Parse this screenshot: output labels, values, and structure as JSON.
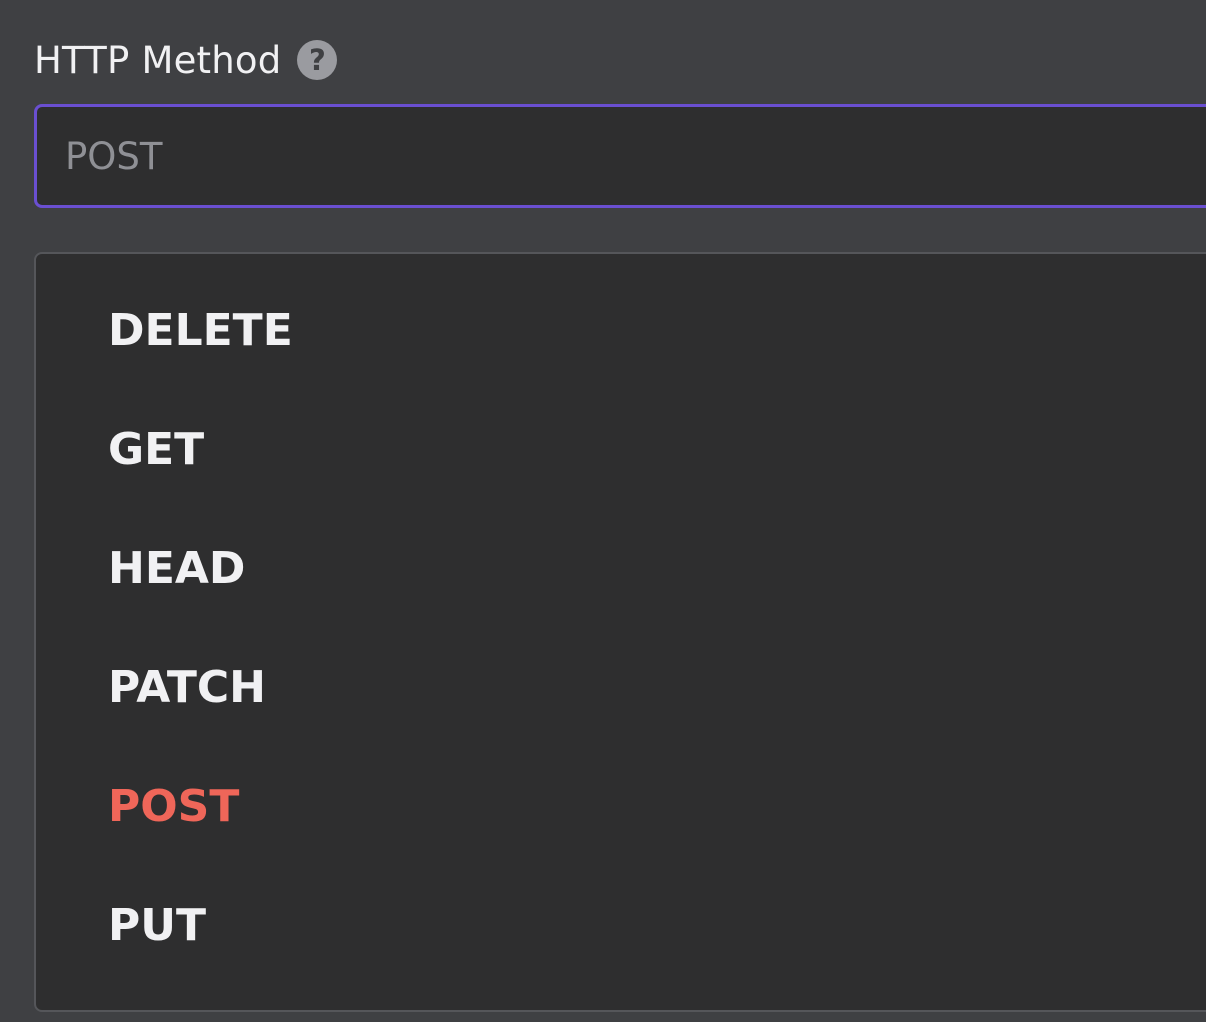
{
  "field": {
    "label": "HTTP Method",
    "help_icon": "question-circle-icon",
    "help_glyph": "?"
  },
  "select": {
    "value": "POST"
  },
  "options": [
    {
      "label": "DELETE",
      "selected": false
    },
    {
      "label": "GET",
      "selected": false
    },
    {
      "label": "HEAD",
      "selected": false
    },
    {
      "label": "PATCH",
      "selected": false
    },
    {
      "label": "POST",
      "selected": true
    },
    {
      "label": "PUT",
      "selected": false
    }
  ],
  "colors": {
    "background": "#3f4043",
    "input_bg": "#2e2e2f",
    "focus_border": "#6a4fd1",
    "selected_option": "#ef6659",
    "text": "#f1f1f3",
    "placeholder_text": "#8f9095"
  }
}
